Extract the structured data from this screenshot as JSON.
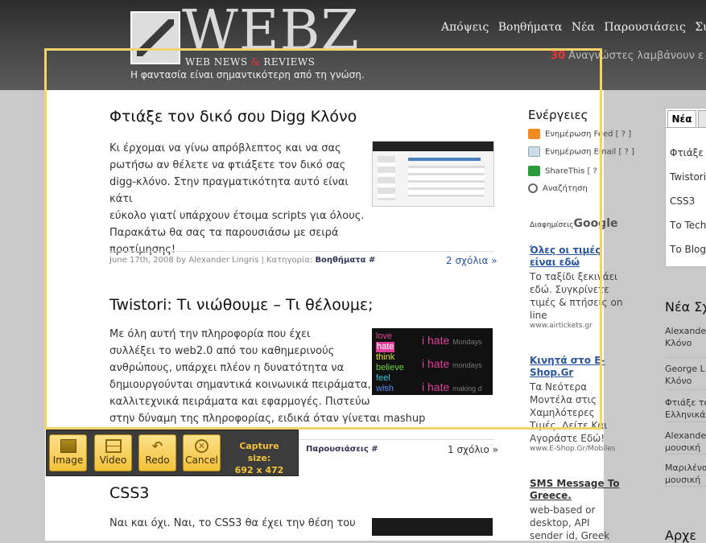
{
  "header": {
    "logo_word": "WEBZ",
    "logo_sub_a": "WEB NEWS ",
    "logo_sub_amp": "&",
    "logo_sub_b": " REVIEWS",
    "tagline": "Η φαντασία είναι σημαντικότερη από τη γνώση.",
    "nav": [
      "Απόψεις",
      "Βοηθήματα",
      "Νέα",
      "Παρουσιάσεις",
      "Συνεντ"
    ],
    "readers_count": "30",
    "readers_text": "Αναγνώστες λαμβάνουν ε"
  },
  "posts": [
    {
      "title": "Φτιάξε τον δικό σου Digg Κλόνο",
      "lines": [
        "Κι έρχομαι να γίνω απρόβλεπτος και να σας",
        "ρωτήσω αν θέλετε να φτιάξετε τον δικό σας",
        "digg-κλόνο. Στην πραγματικότητα αυτό είναι κάτι",
        "εύκολο γιατί υπάρχουν έτοιμα scripts για όλους.",
        "Παρακάτω θα σας τα παρουσιάσω με σειρά",
        "προτίμησης!"
      ],
      "meta": "June 17th, 2008 by Alexander Lingris | Κατηγορία:",
      "category": "Βοηθήματα #",
      "comments": "2 σχόλια »"
    },
    {
      "title": "Twistori: Τι νιώθουμε – Τι θέλουμε;",
      "lines": [
        "Με όλη αυτή την πληροφορία που έχει",
        "συλλέξει το web2.0 από του καθημερινούς",
        "ανθρώπους, υπάρχει πλέον η δυνατότητα να",
        "δημιουργούνται σημαντικά κοινωνικά πειράματα,",
        "καλλιτεχνικά πειράματα και εφαρμογές. Πιστεύω",
        "στην δύναμη της πληροφορίας, ειδικά όταν γίνεται mashup :P."
      ],
      "category": "Παρουσιάσεις #",
      "comments": "1 σχόλιο »",
      "thumb": {
        "left": [
          "love",
          "hate",
          "think",
          "believe",
          "feel",
          "wish"
        ],
        "right": [
          "i hate",
          "i hate",
          "i hate"
        ],
        "right_tail": [
          "Mondays",
          "mondays",
          "making d"
        ]
      }
    },
    {
      "title": "CSS3",
      "lines": [
        "Ναι και όχι. Ναι, το CSS3 θα έχει την θέση του"
      ]
    }
  ],
  "sidebar": {
    "title": "Ενέργειες",
    "links": [
      {
        "label": "Ενημέρωση Feed [ ? ]",
        "icon": "rss-icon"
      },
      {
        "label": "Ενημέρωση Email [ ? ]",
        "icon": "email-icon"
      },
      {
        "label": "ShareThis  [ ? ]",
        "icon": "share-icon"
      },
      {
        "label": "Αναζήτηση",
        "icon": "search-icon"
      }
    ],
    "ads_label": "Διαφημίσεις",
    "ads_brand": "Google",
    "ads": [
      {
        "title": "Όλες οι τιμές είναι εδώ",
        "text": "Το ταξίδι ξεκινάει εδώ. Συγκρίνετε τιμές & πτήσεις on line",
        "url": "www.airtickets.gr"
      },
      {
        "title": "Κινητά στο E-Shop.Gr",
        "text": "Τα Νεότερα Μοντέλα στις Χαμηλότερες Τιμές. Δείτε Και Αγοράστε Εδώ!",
        "url": "www.E-Shop.Gr/Mobiles"
      },
      {
        "title": "SMS Message To Greece.",
        "text": "web-based or desktop, API sender id, Greek"
      }
    ]
  },
  "right_column": {
    "tabs": [
      "Νέα",
      ""
    ],
    "items": [
      "Φτιάξε τ",
      "Twistori:",
      "CSS3",
      "Το Techn",
      "Το Blog"
    ],
    "news_title": "Νέα Σχ",
    "news": [
      [
        "Alexander",
        "Κλόνο"
      ],
      [
        "George L",
        "Κλόνο"
      ],
      [
        "Φτιάξε το",
        "Ελληνικά"
      ],
      [
        "Alexander",
        "μουσική"
      ],
      [
        "Μαριλένα",
        "μουσική"
      ]
    ],
    "bottom_title": "Αρχε"
  },
  "capture_toolbar": {
    "buttons": [
      "Image",
      "Video",
      "Redo",
      "Cancel"
    ],
    "size_label": "Capture size:",
    "size_value": "692 x 472"
  },
  "colors": {
    "accent_yellow": "#f3d46a",
    "link_blue": "#2a56a0",
    "brand_red": "#e33333"
  }
}
